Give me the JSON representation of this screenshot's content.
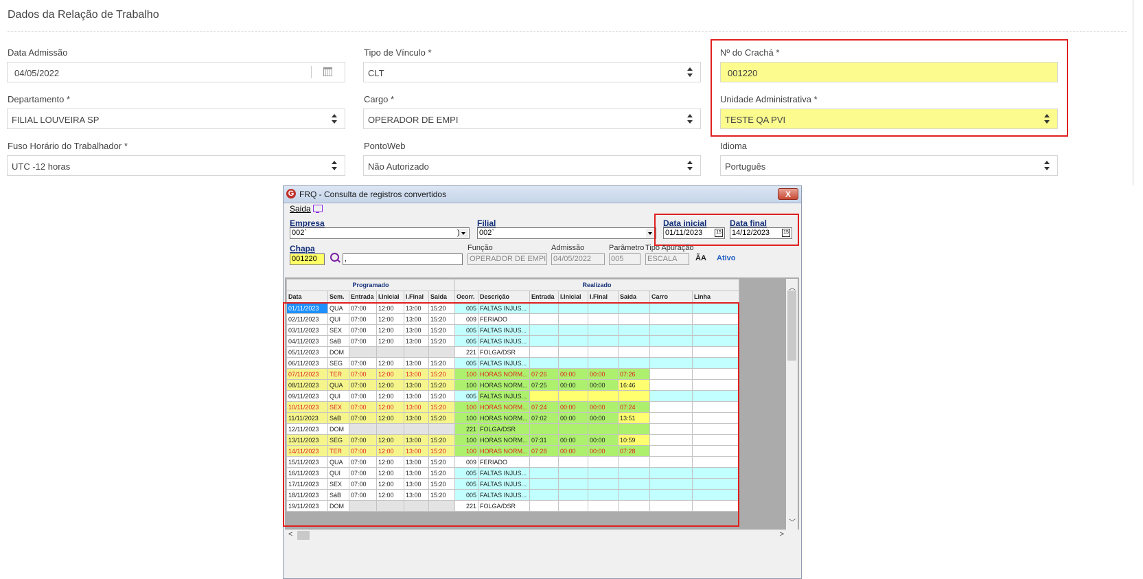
{
  "form": {
    "section_title": "Dados da Relação de Trabalho",
    "data_admissao": {
      "label": "Data Admissão",
      "value": "04/05/2022"
    },
    "tipo_vinculo": {
      "label": "Tipo de Vínculo *",
      "value": "CLT"
    },
    "cracha": {
      "label": "Nº do Crachá *",
      "value": "001220"
    },
    "departamento": {
      "label": "Departamento *",
      "value": "FILIAL LOUVEIRA SP"
    },
    "cargo": {
      "label": "Cargo *",
      "value": "OPERADOR DE EMPI"
    },
    "unidade": {
      "label": "Unidade Administrativa *",
      "value": "TESTE QA PVI"
    },
    "fuso": {
      "label": "Fuso Horário do Trabalhador *",
      "value": "UTC -12 horas"
    },
    "pontoweb": {
      "label": "PontoWeb",
      "value": "Não Autorizado"
    },
    "idioma": {
      "label": "Idioma",
      "value": "Português"
    }
  },
  "window": {
    "title": "FRQ - Consulta de registros convertidos",
    "close": "X",
    "menu_saida": "Saida",
    "empresa": {
      "label": "Empresa",
      "value": "002`",
      "right": ")"
    },
    "filial": {
      "label": "Filial",
      "value": "002`"
    },
    "data_inicial": {
      "label": "Data inicial",
      "value": "01/11/2023"
    },
    "data_final": {
      "label": "Data final",
      "value": "14/12/2023"
    },
    "cal_glyph": "15",
    "chapa": {
      "label": "Chapa",
      "value": "001220",
      "name_value": ","
    },
    "funcao": {
      "label": "Função",
      "value": "OPERADOR DE EMPI"
    },
    "admissao": {
      "label": "Admissão",
      "value": "04/05/2022"
    },
    "parametro": {
      "label": "Parâmetro",
      "value": "005"
    },
    "tipo_apuracao": {
      "label": "Tipo Apuração",
      "value": "ESCALA"
    },
    "aa": "ÃA",
    "ativo": "Ativo",
    "grid": {
      "group_programado": "Programado",
      "group_realizado": "Realizado",
      "columns": [
        "Data",
        "Sem.",
        "Entrada",
        "I.Inicial",
        "I.Final",
        "Saida",
        "Ocorr.",
        "Descrição",
        "Entrada",
        "I.Inicial",
        "I.Final",
        "Saida",
        "Carro",
        "Linha"
      ],
      "rows": [
        {
          "cells": [
            "01/11/2023",
            "QUA",
            "07:00",
            "12:00",
            "13:00",
            "15:20",
            "005",
            "FALTAS INJUS...",
            "",
            "",
            "",
            "",
            "",
            ""
          ]
        },
        {
          "cells": [
            "02/11/2023",
            "QUI",
            "07:00",
            "12:00",
            "13:00",
            "15:20",
            "009",
            "FERIADO",
            "",
            "",
            "",
            "",
            "",
            ""
          ]
        },
        {
          "cells": [
            "03/11/2023",
            "SEX",
            "07:00",
            "12:00",
            "13:00",
            "15:20",
            "005",
            "FALTAS INJUS...",
            "",
            "",
            "",
            "",
            "",
            ""
          ]
        },
        {
          "cells": [
            "04/11/2023",
            "SáB",
            "07:00",
            "12:00",
            "13:00",
            "15:20",
            "005",
            "FALTAS INJUS...",
            "",
            "",
            "",
            "",
            "",
            ""
          ]
        },
        {
          "cells": [
            "05/11/2023",
            "DOM",
            "",
            "",
            "",
            "",
            "221",
            "FOLGA/DSR",
            "",
            "",
            "",
            "",
            "",
            ""
          ]
        },
        {
          "cells": [
            "06/11/2023",
            "SEG",
            "07:00",
            "12:00",
            "13:00",
            "15:20",
            "005",
            "FALTAS INJUS...",
            "",
            "",
            "",
            "",
            "",
            ""
          ]
        },
        {
          "cells": [
            "07/11/2023",
            "TER",
            "07:00",
            "12:00",
            "13:00",
            "15:20",
            "100",
            "HORAS NORM...",
            "07:26",
            "00:00",
            "00:00",
            "07:26",
            "",
            ""
          ]
        },
        {
          "cells": [
            "08/11/2023",
            "QUA",
            "07:00",
            "12:00",
            "13:00",
            "15:20",
            "100",
            "HORAS NORM...",
            "07:25",
            "00:00",
            "00:00",
            "16:46",
            "",
            ""
          ]
        },
        {
          "cells": [
            "09/11/2023",
            "QUI",
            "07:00",
            "12:00",
            "13:00",
            "15:20",
            "005",
            "FALTAS INJUS...",
            "",
            "",
            "",
            "",
            "",
            ""
          ]
        },
        {
          "cells": [
            "10/11/2023",
            "SEX",
            "07:00",
            "12:00",
            "13:00",
            "15:20",
            "100",
            "HORAS NORM...",
            "07:24",
            "00:00",
            "00:00",
            "07:24",
            "",
            ""
          ]
        },
        {
          "cells": [
            "11/11/2023",
            "SáB",
            "07:00",
            "12:00",
            "13:00",
            "15:20",
            "100",
            "HORAS NORM...",
            "07:02",
            "00:00",
            "00:00",
            "13:51",
            "",
            ""
          ]
        },
        {
          "cells": [
            "12/11/2023",
            "DOM",
            "",
            "",
            "",
            "",
            "221",
            "FOLGA/DSR",
            "",
            "",
            "",
            "",
            "",
            ""
          ]
        },
        {
          "cells": [
            "13/11/2023",
            "SEG",
            "07:00",
            "12:00",
            "13:00",
            "15:20",
            "100",
            "HORAS NORM...",
            "07:31",
            "00:00",
            "00:00",
            "10:59",
            "",
            ""
          ]
        },
        {
          "cells": [
            "14/11/2023",
            "TER",
            "07:00",
            "12:00",
            "13:00",
            "15:20",
            "100",
            "HORAS NORM...",
            "07:28",
            "00:00",
            "00:00",
            "07:28",
            "",
            ""
          ]
        },
        {
          "cells": [
            "15/11/2023",
            "QUA",
            "07:00",
            "12:00",
            "13:00",
            "15:20",
            "009",
            "FERIADO",
            "",
            "",
            "",
            "",
            "",
            ""
          ]
        },
        {
          "cells": [
            "16/11/2023",
            "QUI",
            "07:00",
            "12:00",
            "13:00",
            "15:20",
            "005",
            "FALTAS INJUS...",
            "",
            "",
            "",
            "",
            "",
            ""
          ]
        },
        {
          "cells": [
            "17/11/2023",
            "SEX",
            "07:00",
            "12:00",
            "13:00",
            "15:20",
            "005",
            "FALTAS INJUS...",
            "",
            "",
            "",
            "",
            "",
            ""
          ]
        },
        {
          "cells": [
            "18/11/2023",
            "SáB",
            "07:00",
            "12:00",
            "13:00",
            "15:20",
            "005",
            "FALTAS INJUS...",
            "",
            "",
            "",
            "",
            "",
            ""
          ]
        },
        {
          "cells": [
            "19/11/2023",
            "DOM",
            "",
            "",
            "",
            "",
            "221",
            "FOLGA/DSR",
            "",
            "",
            "",
            "",
            "",
            ""
          ]
        }
      ]
    }
  }
}
